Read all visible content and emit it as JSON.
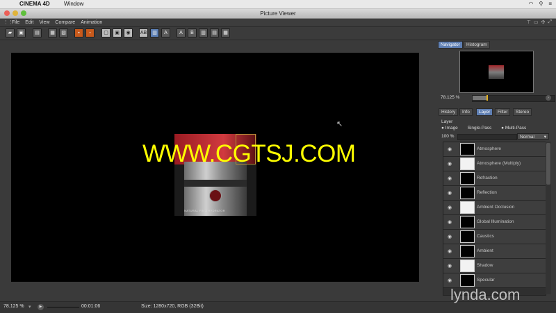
{
  "mac_menubar": {
    "app": "CINEMA 4D",
    "window": "Window",
    "apple_icon": "apple-icon"
  },
  "window": {
    "title": "Picture Viewer"
  },
  "menu": [
    "File",
    "Edit",
    "View",
    "Compare",
    "Animation"
  ],
  "viewer": {
    "watermark": "WWW.CGTSJ.COM",
    "render_label": "NATURAL FIN A HYDRATOR",
    "background": "#000000"
  },
  "status": {
    "zoom": "78.125 %",
    "time": "00:01:06",
    "size": "Size: 1280x720, RGB (32Bit)"
  },
  "panel": {
    "top_tabs": [
      "Navigator",
      "Histogram"
    ],
    "active_top_tab": "Navigator",
    "nav_zoom": "78.125 %",
    "nav_zoom_fraction": 0.18,
    "lower_tabs": [
      "History",
      "Info",
      "Layer",
      "Filter",
      "Stereo"
    ],
    "active_lower_tab": "Layer",
    "layer_heading": "Layer",
    "modes": [
      "Image",
      "Single-Pass",
      "Multi-Pass"
    ],
    "layer_opacity": "100 %",
    "blend_mode": "Normal",
    "layers": [
      {
        "name": "Atmosphere",
        "thumb": "black"
      },
      {
        "name": "Atmosphere (Multiply)",
        "thumb": "white"
      },
      {
        "name": "Refraction",
        "thumb": "black"
      },
      {
        "name": "Reflection",
        "thumb": "black"
      },
      {
        "name": "Ambient Occlusion",
        "thumb": "white"
      },
      {
        "name": "Global Illumination",
        "thumb": "black"
      },
      {
        "name": "Caustics",
        "thumb": "black"
      },
      {
        "name": "Ambient",
        "thumb": "black"
      },
      {
        "name": "Shadow",
        "thumb": "white"
      },
      {
        "name": "Specular",
        "thumb": "black"
      }
    ]
  },
  "brand_watermark": "lynda.com",
  "colors": {
    "accent": "#5f7fb3",
    "watermark": "#ffff00",
    "toolbar_orange": "#c85a1c"
  }
}
